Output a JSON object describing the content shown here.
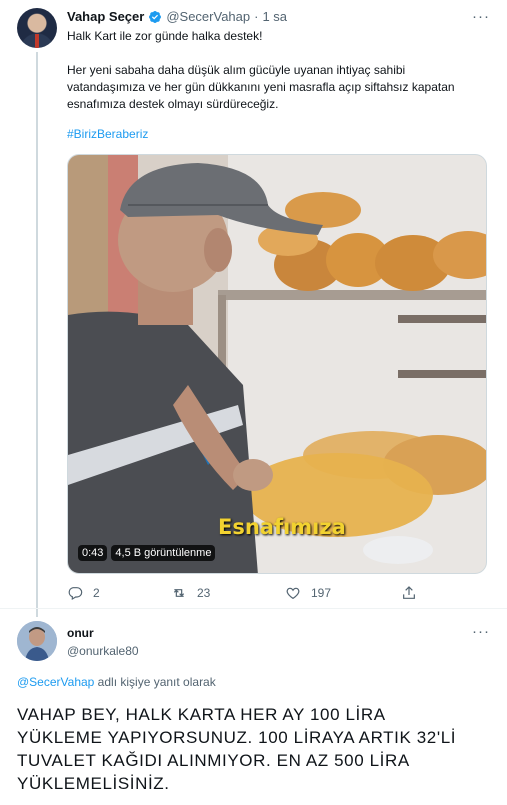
{
  "tweet1": {
    "author_name": "Vahap Seçer",
    "handle": "@SecerVahap",
    "separator": "·",
    "time": "1 sa",
    "more": "···",
    "line1": "Halk Kart ile zor günde halka destek!",
    "paragraph_lines": [
      "Her yeni sabaha daha düşük alım gücüyle uyanan ihtiyaç sahibi",
      "vatandaşımıza ve her gün dükkanını yeni masrafla açıp siftahsız kapatan",
      "esnafımıza destek olmayı sürdüreceğiz."
    ],
    "hashtag": "#BirizBeraberiz",
    "video": {
      "duration": "0:43",
      "views": "4,5 B görüntülenme",
      "caption": "Esnafımıza"
    },
    "actions": {
      "replies": "2",
      "retweets": "23",
      "likes": "197"
    }
  },
  "tweet2": {
    "author_name": "onur",
    "handle": "@onurkale80",
    "more": "···",
    "reply_handle": "@SecerVahap",
    "reply_suffix": " adlı kişiye yanıt olarak",
    "text_lines": [
      "VAHAP BEY, HALK KARTA HER AY 100 LİRA",
      "YÜKLEME YAPIYORSUNUZ. 100 LİRAYA ARTIK 32'Lİ",
      "TUVALET KAĞIDI ALINMIYOR. EN AZ 500 LİRA",
      "YÜKLEMELİSİNİZ."
    ]
  },
  "colors": {
    "accent": "#1d9bf0",
    "secondary_text": "#536471",
    "primary_text": "#0f1419",
    "caption": "#f2d230"
  }
}
